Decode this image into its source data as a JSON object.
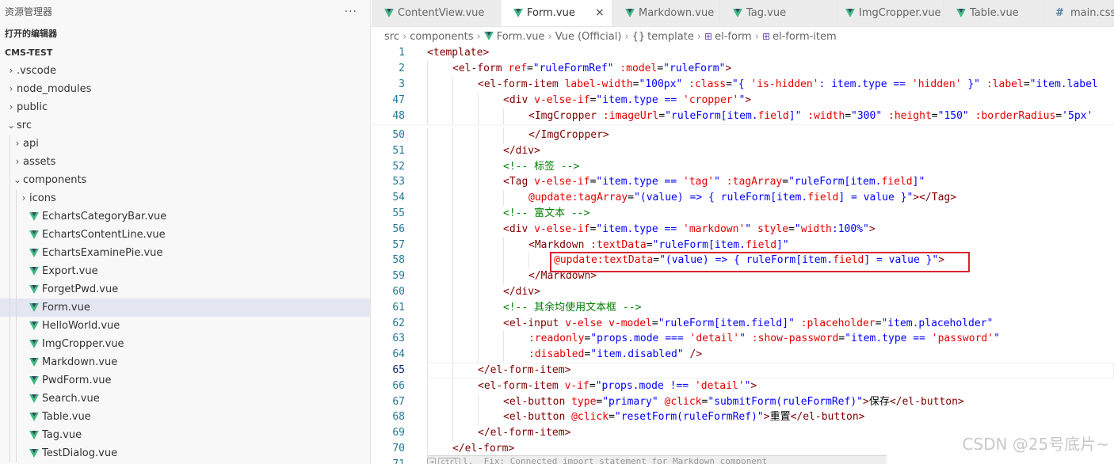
{
  "sidebar": {
    "title": "资源管理器",
    "more_label": "···",
    "open_editors_label": "打开的编辑器",
    "project_label": "CMS-TEST",
    "items": [
      {
        "label": ".vscode",
        "chevron": "›",
        "type": "folder"
      },
      {
        "label": "node_modules",
        "chevron": "›",
        "type": "folder"
      },
      {
        "label": "public",
        "chevron": "›",
        "type": "folder"
      },
      {
        "label": "src",
        "chevron": "⌄",
        "type": "folder"
      },
      {
        "label": "api",
        "chevron": "›",
        "type": "folder"
      },
      {
        "label": "assets",
        "chevron": "›",
        "type": "folder"
      },
      {
        "label": "components",
        "chevron": "⌄",
        "type": "folder"
      },
      {
        "label": "icons",
        "chevron": "›",
        "type": "folder"
      },
      {
        "label": "EchartsCategoryBar.vue",
        "type": "vue"
      },
      {
        "label": "EchartsContentLine.vue",
        "type": "vue"
      },
      {
        "label": "EchartsExaminePie.vue",
        "type": "vue"
      },
      {
        "label": "Export.vue",
        "type": "vue"
      },
      {
        "label": "ForgetPwd.vue",
        "type": "vue"
      },
      {
        "label": "Form.vue",
        "type": "vue",
        "active": true
      },
      {
        "label": "HelloWorld.vue",
        "type": "vue"
      },
      {
        "label": "ImgCropper.vue",
        "type": "vue"
      },
      {
        "label": "Markdown.vue",
        "type": "vue"
      },
      {
        "label": "PwdForm.vue",
        "type": "vue"
      },
      {
        "label": "Search.vue",
        "type": "vue"
      },
      {
        "label": "Table.vue",
        "type": "vue"
      },
      {
        "label": "Tag.vue",
        "type": "vue"
      },
      {
        "label": "TestDialog.vue",
        "type": "vue"
      }
    ]
  },
  "tabs": [
    {
      "label": "ContentView.vue",
      "icon": "vue-icon"
    },
    {
      "label": "Form.vue",
      "icon": "vue-icon",
      "active": true,
      "close": "×"
    },
    {
      "label": "Markdown.vue",
      "icon": "vue-icon"
    },
    {
      "label": "Tag.vue",
      "icon": "vue-icon"
    },
    {
      "label": "ImgCropper.vue",
      "icon": "vue-icon"
    },
    {
      "label": "Table.vue",
      "icon": "vue-icon"
    },
    {
      "label": "main.css",
      "icon": "hash-icon",
      "glyph": "#"
    }
  ],
  "breadcrumb": {
    "src": "src",
    "components": "components",
    "file": "Form.vue",
    "language": "Vue (Official)",
    "template": "template",
    "el_form": "el-form",
    "el_form_item": "el-form-item",
    "sep": "›",
    "braces": "{}",
    "cube": "⊞"
  },
  "editor": {
    "lines": [
      {
        "num": "1",
        "sticky": true,
        "indent": 0,
        "tokens": [
          [
            "tg",
            "<template>"
          ]
        ]
      },
      {
        "num": "2",
        "sticky": true,
        "indent": 1,
        "tokens": [
          [
            "tg",
            "<el-form "
          ],
          [
            "at",
            "ref"
          ],
          [
            "op",
            "="
          ],
          [
            "st",
            "\"ruleFormRef\""
          ],
          [
            "op",
            " "
          ],
          [
            "at",
            ":model"
          ],
          [
            "op",
            "="
          ],
          [
            "st",
            "\"ruleForm\""
          ],
          [
            "tg",
            ">"
          ]
        ]
      },
      {
        "num": "3",
        "sticky": true,
        "indent": 2,
        "tokens": [
          [
            "tg",
            "<el-form-item "
          ],
          [
            "at",
            "label-width"
          ],
          [
            "op",
            "="
          ],
          [
            "st",
            "\"100px\""
          ],
          [
            "op",
            " "
          ],
          [
            "at",
            ":class"
          ],
          [
            "op",
            "="
          ],
          [
            "st",
            "\"{ "
          ],
          [
            "at",
            "'is-hidden'"
          ],
          [
            "st",
            ": item.type == "
          ],
          [
            "at",
            "'hidden'"
          ],
          [
            "st",
            " }\""
          ],
          [
            "op",
            " "
          ],
          [
            "at",
            ":label"
          ],
          [
            "op",
            "="
          ],
          [
            "st",
            "\"item.label"
          ]
        ]
      },
      {
        "num": "47",
        "sticky": true,
        "indent": 3,
        "tokens": [
          [
            "tg",
            "<div "
          ],
          [
            "at",
            "v-else-if"
          ],
          [
            "op",
            "="
          ],
          [
            "st",
            "\"item.type == "
          ],
          [
            "at",
            "'cropper'"
          ],
          [
            "st",
            "\""
          ],
          [
            "tg",
            ">"
          ]
        ]
      },
      {
        "num": "48",
        "sticky": true,
        "indent": 4,
        "tokens": [
          [
            "tg",
            "<ImgCropper "
          ],
          [
            "at",
            ":imageUrl"
          ],
          [
            "op",
            "="
          ],
          [
            "st",
            "\"ruleForm[item."
          ],
          [
            "at",
            "field"
          ],
          [
            "st",
            "]\""
          ],
          [
            "op",
            " "
          ],
          [
            "at",
            ":width"
          ],
          [
            "op",
            "="
          ],
          [
            "st",
            "\"300\""
          ],
          [
            "op",
            " "
          ],
          [
            "at",
            ":height"
          ],
          [
            "op",
            "="
          ],
          [
            "st",
            "\"150\""
          ],
          [
            "op",
            " "
          ],
          [
            "at",
            ":borderRadius"
          ],
          [
            "op",
            "="
          ],
          [
            "st",
            "'5px'"
          ]
        ]
      },
      {
        "num": "50",
        "indent": 4,
        "tokens": [
          [
            "tg",
            "</ImgCropper>"
          ]
        ]
      },
      {
        "num": "51",
        "indent": 3,
        "tokens": [
          [
            "tg",
            "</div>"
          ]
        ]
      },
      {
        "num": "52",
        "indent": 3,
        "tokens": [
          [
            "cm",
            "<!-- 标签 -->"
          ]
        ]
      },
      {
        "num": "53",
        "indent": 3,
        "tokens": [
          [
            "tg",
            "<Tag "
          ],
          [
            "at",
            "v-else-if"
          ],
          [
            "op",
            "="
          ],
          [
            "st",
            "\"item.type == "
          ],
          [
            "at",
            "'tag'"
          ],
          [
            "st",
            "\""
          ],
          [
            "op",
            " "
          ],
          [
            "at",
            ":tagArray"
          ],
          [
            "op",
            "="
          ],
          [
            "st",
            "\"ruleForm[item."
          ],
          [
            "at",
            "field"
          ],
          [
            "st",
            "]\""
          ]
        ]
      },
      {
        "num": "54",
        "indent": 4,
        "tokens": [
          [
            "at",
            "@update:tagArray"
          ],
          [
            "op",
            "="
          ],
          [
            "st",
            "\"(value) => { ruleForm[item."
          ],
          [
            "at",
            "field"
          ],
          [
            "st",
            "] = value }\""
          ],
          [
            "tg",
            "></Tag>"
          ]
        ]
      },
      {
        "num": "55",
        "indent": 3,
        "tokens": [
          [
            "cm",
            "<!-- 富文本 -->"
          ]
        ]
      },
      {
        "num": "56",
        "indent": 3,
        "tokens": [
          [
            "tg",
            "<div "
          ],
          [
            "at",
            "v-else-if"
          ],
          [
            "op",
            "="
          ],
          [
            "st",
            "\"item.type == "
          ],
          [
            "at",
            "'markdown'"
          ],
          [
            "st",
            "\""
          ],
          [
            "op",
            " "
          ],
          [
            "at",
            "style"
          ],
          [
            "op",
            "="
          ],
          [
            "st",
            "\""
          ],
          [
            "at",
            "width"
          ],
          [
            "st",
            ":100%\""
          ],
          [
            "tg",
            ">"
          ]
        ]
      },
      {
        "num": "57",
        "indent": 4,
        "tokens": [
          [
            "tg",
            "<Markdown "
          ],
          [
            "at",
            ":textData"
          ],
          [
            "op",
            "="
          ],
          [
            "st",
            "\"ruleForm[item."
          ],
          [
            "at",
            "field"
          ],
          [
            "st",
            "]\""
          ]
        ]
      },
      {
        "num": "58",
        "indent": 5,
        "tokens": [
          [
            "at",
            "@update:textData"
          ],
          [
            "op",
            "="
          ],
          [
            "st",
            "\"(value) => { ruleForm[item."
          ],
          [
            "at",
            "field"
          ],
          [
            "st",
            "] = value }\""
          ],
          [
            "tg",
            ">"
          ]
        ]
      },
      {
        "num": "59",
        "indent": 4,
        "tokens": [
          [
            "tg",
            "</Markdown>"
          ]
        ]
      },
      {
        "num": "60",
        "indent": 3,
        "tokens": [
          [
            "tg",
            "</div>"
          ]
        ]
      },
      {
        "num": "61",
        "indent": 3,
        "tokens": [
          [
            "cm",
            "<!-- 其余均使用文本框 -->"
          ]
        ]
      },
      {
        "num": "62",
        "indent": 3,
        "tokens": [
          [
            "tg",
            "<el-input "
          ],
          [
            "at",
            "v-else"
          ],
          [
            "op",
            " "
          ],
          [
            "at",
            "v-model"
          ],
          [
            "op",
            "="
          ],
          [
            "st",
            "\"ruleForm[item.field]\""
          ],
          [
            "op",
            " "
          ],
          [
            "at",
            ":placeholder"
          ],
          [
            "op",
            "="
          ],
          [
            "st",
            "\"item.placeholder\""
          ]
        ]
      },
      {
        "num": "63",
        "indent": 4,
        "tokens": [
          [
            "at",
            ":readonly"
          ],
          [
            "op",
            "="
          ],
          [
            "st",
            "\"props.mode === "
          ],
          [
            "at",
            "'detail'"
          ],
          [
            "st",
            "\""
          ],
          [
            "op",
            " "
          ],
          [
            "at",
            ":show-password"
          ],
          [
            "op",
            "="
          ],
          [
            "st",
            "\"item.type == "
          ],
          [
            "at",
            "'password'"
          ],
          [
            "st",
            "\""
          ]
        ]
      },
      {
        "num": "64",
        "indent": 4,
        "tokens": [
          [
            "at",
            ":disabled"
          ],
          [
            "op",
            "="
          ],
          [
            "st",
            "\"item.disabled\""
          ],
          [
            "op",
            " "
          ],
          [
            "tg",
            "/>"
          ]
        ]
      },
      {
        "num": "65",
        "indent": 2,
        "current": true,
        "tokens": [
          [
            "tg",
            "</el-form-item>"
          ]
        ]
      },
      {
        "num": "66",
        "indent": 2,
        "tokens": [
          [
            "tg",
            "<el-form-item "
          ],
          [
            "at",
            "v-if"
          ],
          [
            "op",
            "="
          ],
          [
            "st",
            "\"props.mode !== "
          ],
          [
            "at",
            "'detail'"
          ],
          [
            "st",
            "\""
          ],
          [
            "tg",
            ">"
          ]
        ]
      },
      {
        "num": "67",
        "indent": 3,
        "tokens": [
          [
            "tg",
            "<el-button "
          ],
          [
            "at",
            "type"
          ],
          [
            "op",
            "="
          ],
          [
            "st",
            "\"primary\""
          ],
          [
            "op",
            " "
          ],
          [
            "at",
            "@click"
          ],
          [
            "op",
            "="
          ],
          [
            "st",
            "\"submitForm(ruleFormRef)\""
          ],
          [
            "tg",
            ">"
          ],
          [
            "op",
            "保存"
          ],
          [
            "tg",
            "</el-button>"
          ]
        ]
      },
      {
        "num": "68",
        "indent": 3,
        "tokens": [
          [
            "tg",
            "<el-button "
          ],
          [
            "at",
            "@click"
          ],
          [
            "op",
            "="
          ],
          [
            "st",
            "\"resetForm(ruleFormRef)\""
          ],
          [
            "tg",
            ">"
          ],
          [
            "op",
            "重置"
          ],
          [
            "tg",
            "</el-button>"
          ]
        ]
      },
      {
        "num": "69",
        "indent": 2,
        "tokens": [
          [
            "tg",
            "</el-form-item>"
          ]
        ]
      },
      {
        "num": "70",
        "indent": 1,
        "tokens": [
          [
            "tg",
            "</el-form>"
          ]
        ]
      },
      {
        "num": "71",
        "indent": 0,
        "tokens": []
      }
    ],
    "ghost_text": "l.  Fix: Connected import statement for Markdown component",
    "watermark": "CSDN @25号底片~"
  }
}
